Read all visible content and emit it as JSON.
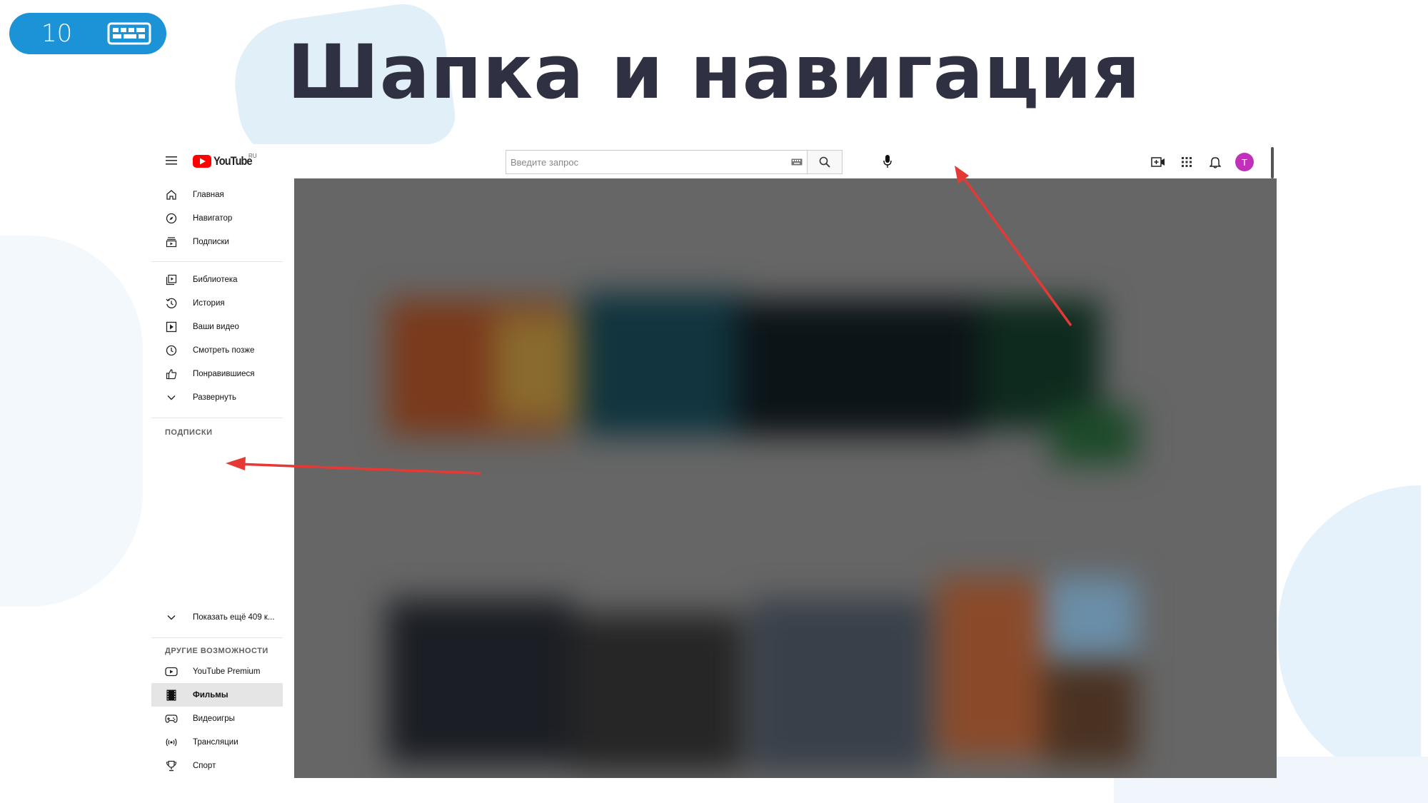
{
  "slide": {
    "number": "10",
    "title": "Шапка и навигация"
  },
  "header": {
    "logo_text": "YouTube",
    "logo_region": "RU",
    "search_placeholder": "Введите запрос",
    "avatar_letter": "T",
    "avatar_color": "#c130b9"
  },
  "sidebar": {
    "main": [
      "Главная",
      "Навигатор",
      "Подписки"
    ],
    "library": [
      "Библиотека",
      "История",
      "Ваши видео",
      "Смотреть позже",
      "Понравившиеся",
      "Развернуть"
    ],
    "subscriptions_title": "ПОДПИСКИ",
    "show_more": "Показать ещё 409 к...",
    "other_title": "ДРУГИЕ ВОЗМОЖНОСТИ",
    "other": [
      "YouTube Premium",
      "Фильмы",
      "Видеоигры",
      "Трансляции",
      "Спорт"
    ],
    "active_item": "Фильмы"
  },
  "colors": {
    "badge": "#1b93d6",
    "title": "#2f3142",
    "youtube_red": "#ff0000",
    "arrow": "#e53935",
    "content_overlay": "#666666"
  }
}
